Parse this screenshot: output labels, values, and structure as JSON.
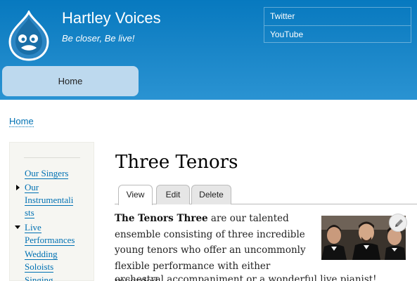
{
  "site": {
    "name": "Hartley Voices",
    "slogan": "Be closer, Be live!"
  },
  "secondary_menu": [
    "Twitter",
    "YouTube"
  ],
  "main_menu": {
    "home": "Home"
  },
  "breadcrumb": "Home",
  "sidebar": {
    "items": [
      {
        "label": "Our Singers"
      },
      {
        "label": "Our Instrumentalists",
        "lines": [
          "Our",
          "Instrumentali",
          "sts"
        ],
        "expandable": "collapsed"
      },
      {
        "label": "Live Performances",
        "lines": [
          "Live",
          "Performances"
        ],
        "expandable": "expanded"
      },
      {
        "label": "Wedding Soloists",
        "lines": [
          "Wedding",
          "Soloists"
        ]
      },
      {
        "label": "Singing"
      }
    ]
  },
  "page": {
    "title": "Three Tenors",
    "tabs": [
      "View",
      "Edit",
      "Delete"
    ],
    "active_tab": "View",
    "body_bold": "The Tenors Three",
    "body_lines": [
      "are our talented",
      "ensemble consisting of three incredible",
      "young tenors who offer an uncommonly",
      "flexible performance with either recorded"
    ],
    "body_overflow": "orchestral accompaniment or a wonderful live pianist!"
  },
  "colors": {
    "header": "#1b87c9",
    "menu_tab": "#bdd9ee",
    "link": "#0071b3",
    "sidebar_bg": "#f6f6f2"
  },
  "icons": {
    "logo": "drupal-drop-logo",
    "expand_collapsed": "triangle-right-icon",
    "expand_open": "triangle-down-icon",
    "edit": "pencil-icon"
  }
}
